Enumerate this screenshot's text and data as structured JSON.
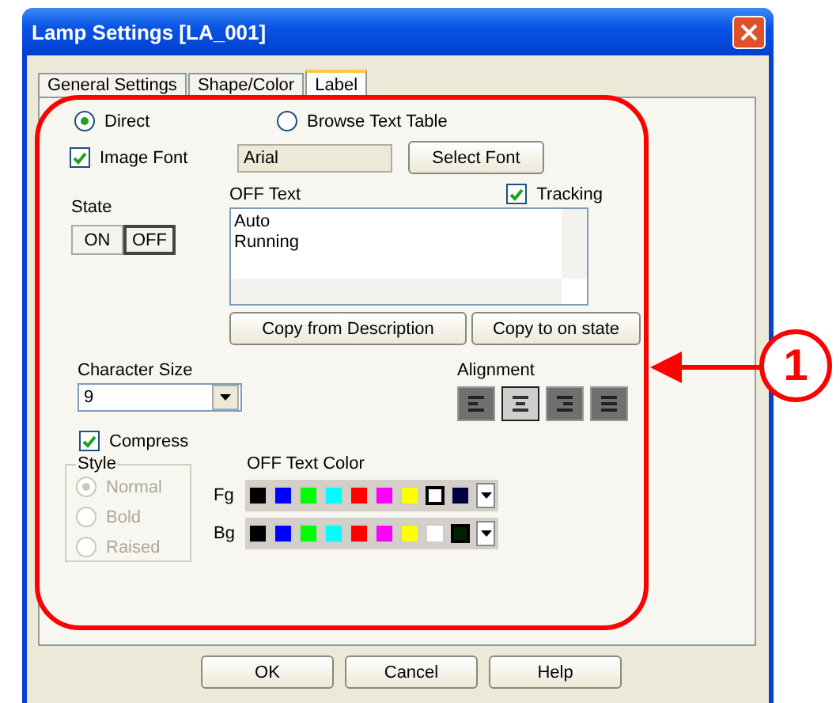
{
  "window": {
    "title": "Lamp Settings [LA_001]"
  },
  "tabs": [
    {
      "label": "General Settings",
      "selected": false
    },
    {
      "label": "Shape/Color",
      "selected": false
    },
    {
      "label": "Label",
      "selected": true
    }
  ],
  "source": [
    {
      "label": "Direct",
      "selected": true
    },
    {
      "label": "Browse Text Table",
      "selected": false
    }
  ],
  "image_font": {
    "label": "Image Font",
    "checked": true,
    "value": "Arial",
    "button": "Select Font"
  },
  "state": {
    "label": "State",
    "options": [
      {
        "label": "ON",
        "selected": false
      },
      {
        "label": "OFF",
        "selected": true
      }
    ]
  },
  "off_text": {
    "label": "OFF Text",
    "lines": [
      "Auto",
      "Running"
    ],
    "tracking": {
      "label": "Tracking",
      "checked": true
    }
  },
  "copy_buttons": [
    "Copy from Description",
    "Copy to on state"
  ],
  "character_size": {
    "label": "Character Size",
    "value": "9"
  },
  "compress": {
    "label": "Compress",
    "checked": true
  },
  "style": {
    "title": "Style",
    "disabled": true,
    "options": [
      {
        "label": "Normal",
        "selected": true
      },
      {
        "label": "Bold",
        "selected": false
      },
      {
        "label": "Raised",
        "selected": false
      }
    ]
  },
  "alignment": {
    "label": "Alignment",
    "options": [
      {
        "kind": "left",
        "selected": false
      },
      {
        "kind": "center",
        "selected": true
      },
      {
        "kind": "right",
        "selected": false
      },
      {
        "kind": "fill",
        "selected": false
      }
    ]
  },
  "text_color": {
    "title": "OFF Text Color",
    "rows": [
      {
        "label": "Fg",
        "swatches": [
          {
            "color": "#000000",
            "selected": false
          },
          {
            "color": "#0000ff",
            "selected": false
          },
          {
            "color": "#00ff00",
            "selected": false
          },
          {
            "color": "#00ffff",
            "selected": false
          },
          {
            "color": "#ff0000",
            "selected": false
          },
          {
            "color": "#ff00ff",
            "selected": false
          },
          {
            "color": "#ffff00",
            "selected": false
          },
          {
            "color": "#ffffff",
            "selected": true
          },
          {
            "color": "#000040",
            "selected": false
          }
        ]
      },
      {
        "label": "Bg",
        "swatches": [
          {
            "color": "#000000",
            "selected": false
          },
          {
            "color": "#0000ff",
            "selected": false
          },
          {
            "color": "#00ff00",
            "selected": false
          },
          {
            "color": "#00ffff",
            "selected": false
          },
          {
            "color": "#ff0000",
            "selected": false
          },
          {
            "color": "#ff00ff",
            "selected": false
          },
          {
            "color": "#ffff00",
            "selected": false
          },
          {
            "color": "#ffffff",
            "selected": false
          },
          {
            "color": "#002000",
            "selected": true
          }
        ]
      }
    ]
  },
  "footer_buttons": [
    "OK",
    "Cancel",
    "Help"
  ],
  "callout": {
    "number": "1"
  }
}
